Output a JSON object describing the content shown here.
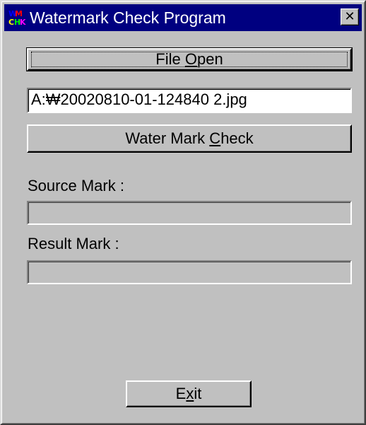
{
  "window": {
    "title": "Watermark Check Program",
    "close_label": "✕"
  },
  "app_icon": {
    "glyphs": [
      {
        "text": "W",
        "color": "#0000ff"
      },
      {
        "text": "M",
        "color": "#ff0000"
      },
      {
        "text": "C",
        "color": "#ffff00"
      },
      {
        "text": "H",
        "color": "#00ff00"
      },
      {
        "text": "K",
        "color": "#ff00ff"
      }
    ]
  },
  "file_open_button": {
    "label_before": "File ",
    "mnemonic": "O",
    "label_after": "pen"
  },
  "file_path": {
    "value": "A:₩20020810-01-124840 2.jpg"
  },
  "check_button": {
    "label_before": "Water Mark ",
    "mnemonic": "C",
    "label_after": "heck"
  },
  "source_mark": {
    "label": "Source Mark :",
    "value": ""
  },
  "result_mark": {
    "label": "Result Mark  :",
    "value": ""
  },
  "exit_button": {
    "label_before": "E",
    "mnemonic": "x",
    "label_after": "it"
  },
  "colors": {
    "titlebar": "#000080",
    "face": "#c0c0c0"
  }
}
